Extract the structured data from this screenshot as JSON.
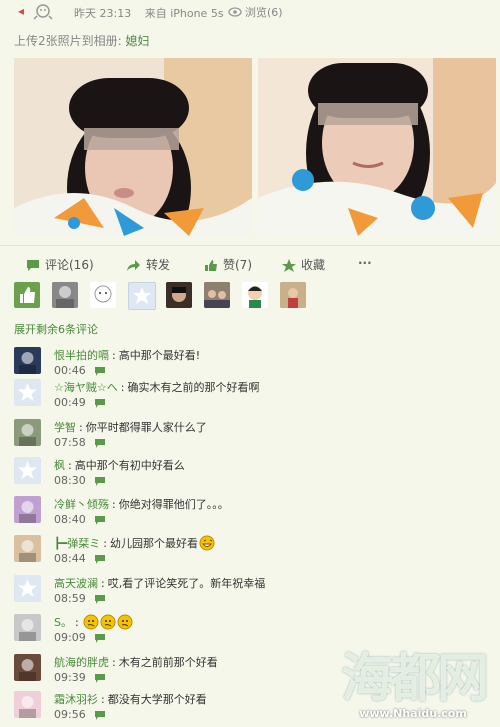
{
  "post": {
    "time": "昨天 23:13",
    "source": "来自 iPhone 5s",
    "views": "浏览(6)",
    "upload_prefix": "上传2张照片到相册:",
    "album": "媳妇"
  },
  "actions": {
    "comment": "评论(16)",
    "share": "转发",
    "like": "赞(7)",
    "favorite": "收藏",
    "more": "···"
  },
  "likers_icons": [
    "thumb-icon",
    "avatar-anime",
    "avatar-sketch",
    "avatar-default",
    "avatar-boy",
    "avatar-group",
    "avatar-cartoon",
    "avatar-girl"
  ],
  "expand_text": "展开剩余6条评论",
  "comments": [
    {
      "name": "恨半拍的嗝",
      "text": "高中那个最好看!",
      "time": "00:46"
    },
    {
      "name": "☆海ヤ贼☆へ",
      "text": "确实木有之前的那个好看啊",
      "time": "00:49"
    },
    {
      "name": "学智",
      "text": "你平时都得罪人家什么了",
      "time": "07:58"
    },
    {
      "name": "枫",
      "text": "高中那个有初中好看么",
      "time": "08:30"
    },
    {
      "name": "冷鲜丶倾殇",
      "text": "你绝对得罪他们了。。。",
      "time": "08:40"
    },
    {
      "name": "┣━弹栞ミ",
      "text": "幼儿园那个最好看",
      "time": "08:44"
    },
    {
      "name": "高天波澜",
      "text": "哎,看了评论笑死了。新年祝幸福",
      "time": "08:59"
    },
    {
      "name": "S。",
      "text": "",
      "time": "09:09"
    },
    {
      "name": "航海的胖虎",
      "text": "木有之前前那个好看",
      "time": "09:39"
    },
    {
      "name": "霜沐羽衫",
      "text": "都没有大学那个好看",
      "time": "09:56"
    }
  ],
  "watermark": {
    "big": "海都网",
    "url": "www.Nhaidu.com"
  },
  "colors": {
    "accent": "#4a8a3a",
    "background": "#f4f7ea"
  }
}
